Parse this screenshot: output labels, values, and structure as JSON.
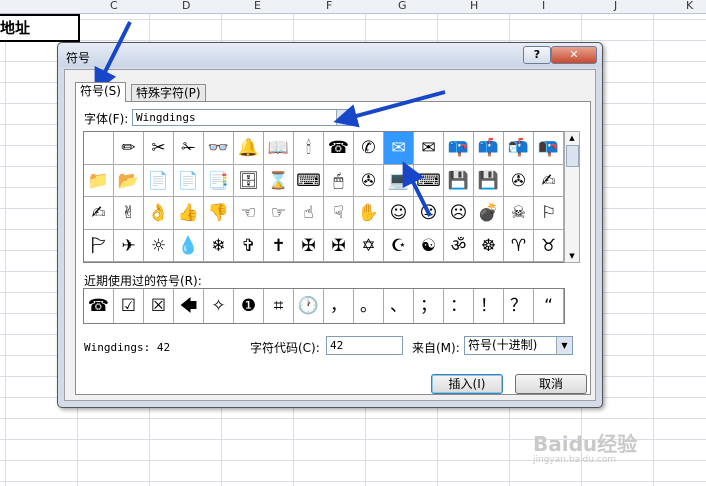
{
  "spreadsheet": {
    "columns": [
      "C",
      "D",
      "E",
      "F",
      "G",
      "H",
      "I",
      "J",
      "K"
    ],
    "cell_text": "地址"
  },
  "dialog": {
    "title": "符号",
    "help_label": "?",
    "close_label": "✕",
    "tabs": [
      {
        "label": "符号(S)",
        "active": true
      },
      {
        "label": "特殊字符(P)",
        "active": false
      }
    ],
    "font_label": "字体(F):",
    "font_value": "Wingdings",
    "symbols": [
      "",
      "✏",
      "✂",
      "✁",
      "👓",
      "🔔",
      "📖",
      "🕯",
      "☎",
      "✆",
      "✉",
      "✉",
      "📪",
      "📫",
      "📬",
      "📭",
      "📁",
      "📂",
      "📄",
      "📄",
      "📑",
      "🗄",
      "⌛",
      "⌨",
      "🖱",
      "✇",
      "💻",
      "⌨",
      "💾",
      "💾",
      "✇",
      "✍",
      "✍",
      "✌",
      "👌",
      "👍",
      "👎",
      "☜",
      "☞",
      "☝",
      "☟",
      "✋",
      "☺",
      "😐",
      "☹",
      "💣",
      "☠",
      "⚐",
      "🏱",
      "✈",
      "☼",
      "💧",
      "❄",
      "✞",
      "✝",
      "✠",
      "✠",
      "✡",
      "☪",
      "☯",
      "ॐ",
      "☸",
      "♈",
      "♉"
    ],
    "selected_index": 10,
    "recent_label": "近期使用过的符号(R):",
    "recent_symbols": [
      "☎",
      "☑",
      "☒",
      "🡄",
      "✧",
      "❶",
      "⌗",
      "🕐",
      "，",
      "。",
      "、",
      "；",
      "：",
      "！",
      "？",
      "“"
    ],
    "char_name": "Wingdings: 42",
    "code_label": "字符代码(C):",
    "code_value": "42",
    "from_label": "来自(M):",
    "from_value": "符号(十进制)",
    "insert_label": "插入(I)",
    "cancel_label": "取消"
  },
  "watermark": {
    "text": "Baidu经验",
    "sub": "jingyan.baidu.com"
  },
  "colors": {
    "arrow": "#1747c8",
    "selected": "#3399ff"
  }
}
